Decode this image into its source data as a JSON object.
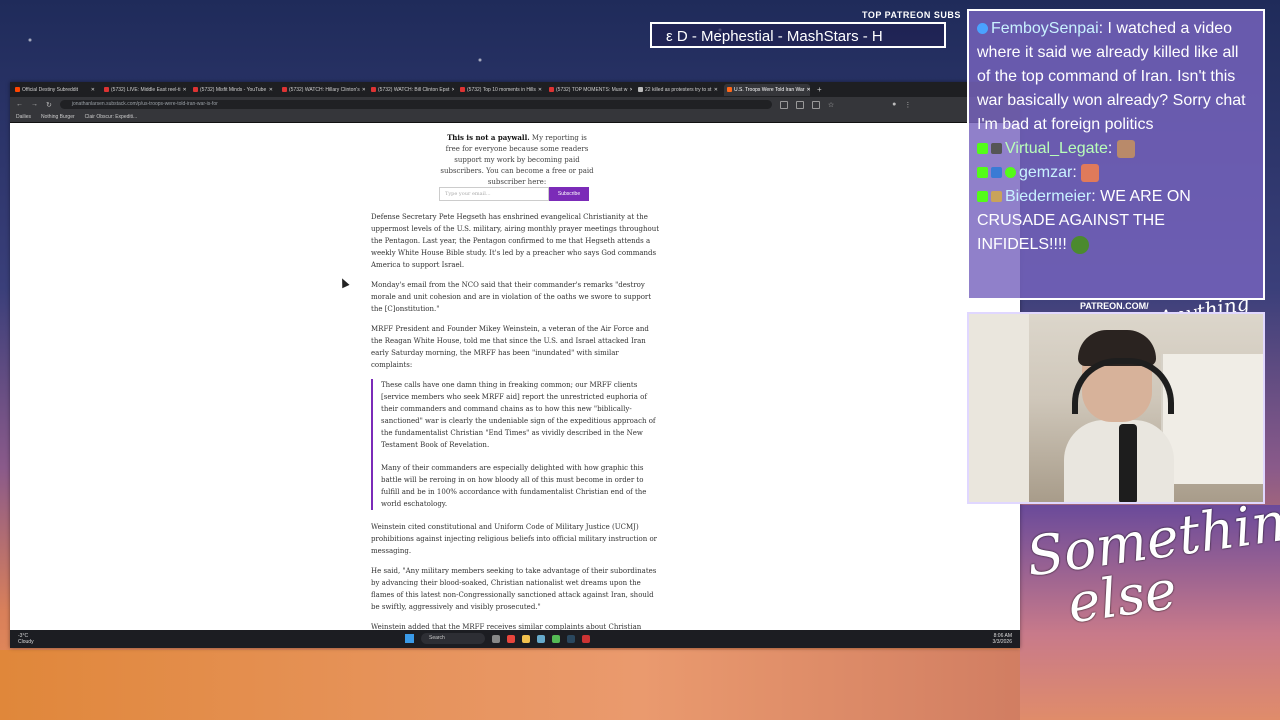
{
  "overlay": {
    "patreon_top": "TOP PATREON SUBS",
    "ticker_text": "ε D - Mephestial - MashStars - H",
    "patreon_cam": "PATREON.COM/",
    "cam_tag": "Anything else",
    "signature": "Something else"
  },
  "browser": {
    "tabs": [
      {
        "label": "Official Destiny Subreddit",
        "active": false
      },
      {
        "label": "(5732) LIVE: Middle East reel-ti",
        "active": false
      },
      {
        "label": "(5732) Misfit Minds - YouTube",
        "active": false
      },
      {
        "label": "(5732) WATCH: Hillary Clinton's",
        "active": false
      },
      {
        "label": "(5732) WATCH: Bill Clinton Epst",
        "active": false
      },
      {
        "label": "(5732) Top 10 moments in Hills",
        "active": false
      },
      {
        "label": "(5732) TOP MOMENTS: Must w",
        "active": false
      },
      {
        "label": "22 killed as protesters try to st",
        "active": false
      },
      {
        "label": "U.S. Troops Were Told Iran War",
        "active": true
      }
    ],
    "url": "jonathanlarsen.substack.com/p/us-troops-were-told-iran-war-is-for",
    "bookmarks": [
      "Dailies",
      "Nothing Burger",
      "Clair Obscur: Expediti..."
    ]
  },
  "article": {
    "paywall_bold": "This is not a paywall.",
    "paywall_text": "My reporting is free for everyone because some readers support my work by becoming paid subscribers. You can become a free or paid subscriber here:",
    "email_placeholder": "Type your email...",
    "subscribe_label": "Subscribe",
    "p1": "Defense Secretary Pete Hegseth has enshrined evangelical Christianity at the uppermost levels of the U.S. military, airing monthly prayer meetings throughout the Pentagon. Last year, the Pentagon confirmed to me that Hegseth attends a weekly White House Bible study. It's led by a preacher who says God commands America to support Israel.",
    "p2": "Monday's email from the NCO said that their commander's remarks \"destroy morale and unit cohesion and are in violation of the oaths we swore to support the [C]onstitution.\"",
    "p3": "MRFF President and Founder Mikey Weinstein, a veteran of the Air Force and the Reagan White House, told me that since the U.S. and Israel attacked Iran early Saturday morning, the MRFF has been \"inundated\" with similar complaints:",
    "q1": "These calls have one damn thing in freaking common; our MRFF clients [service members who seek MRFF aid] report the unrestricted euphoria of their commanders and command chains as to how this new \"biblically-sanctioned\" war is clearly the undeniable sign of the expeditious approach of the fundamentalist Christian \"End Times\" as vividly described in the New Testament Book of Revelation.",
    "q2": "Many of their commanders are especially delighted with how graphic this battle will be reroing in on how bloody all of this must become in order to fulfill and be in 100% accordance with fundamentalist Christian end of the world eschatology.",
    "p4": "Weinstein cited constitutional and Uniform Code of Military Justice (UCMJ) prohibitions against injecting religious beliefs into official military instruction or messaging.",
    "p5": "He said, \"Any military members seeking to take advantage of their subordinates by advancing their blood-soaked, Christian nationalist wet dreams upon the flames of this latest non-Congressionally sanctioned attack against Iran, should be swiftly, aggressively and visibly prosecuted.\"",
    "p6": "Weinstein added that the MRFF receives similar complaints about Christian eschatology — end-of-the-world theology — \"whenever this shit blows up with Israel in the Middle East.\""
  },
  "taskbar": {
    "temp": "-3°C",
    "condition": "Cloudy",
    "search": "Search",
    "time": "8:06 AM",
    "date": "3/3/2026"
  },
  "chat": {
    "messages": [
      {
        "user": "FemboySenpai",
        "text": ": I watched a video where it said we already killed like all of the top command of Iran. Isn't this war basically won already? Sorry chat I'm bad at foreign politics"
      },
      {
        "user": "Virtual_Legate",
        "text": ":"
      },
      {
        "user": "gemzar",
        "text": ":"
      },
      {
        "user": "Biedermeier",
        "text": ": WE ARE ON CRUSADE AGAINST THE INFIDELS!!!!"
      }
    ]
  },
  "colors": {
    "accent_purple": "#7b2bb8",
    "chat_bg": "#7864be"
  }
}
